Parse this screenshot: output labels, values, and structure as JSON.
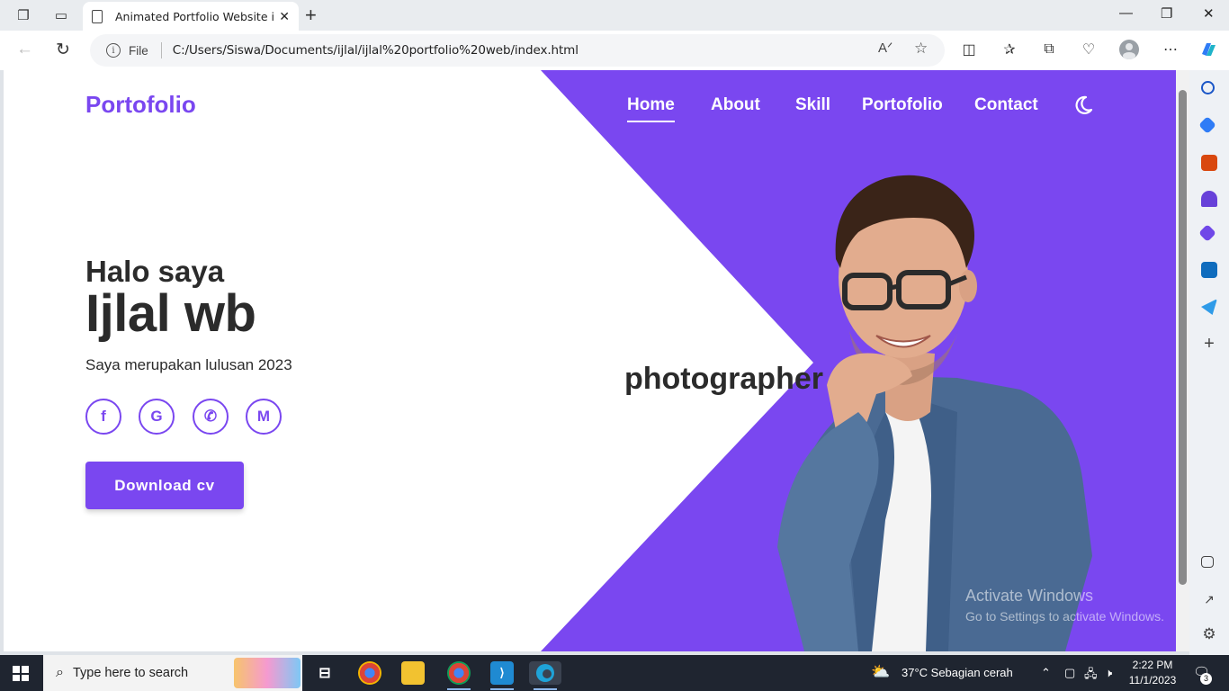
{
  "browser": {
    "tab_title": "Animated Portfolio Website in HTML",
    "address_prefix": "File",
    "url": "C:/Users/Siswa/Documents/ijlal/ijlal%20portfolio%20web/index.html"
  },
  "site": {
    "logo": "Portofolio",
    "nav": [
      "Home",
      "About",
      "Skill",
      "Portofolio",
      "Contact"
    ],
    "greeting": "Halo saya",
    "name": "Ijlal wb",
    "description": "Saya merupakan lulusan 2023",
    "social": [
      {
        "icon": "facebook-icon",
        "glyph": "f"
      },
      {
        "icon": "google-icon",
        "glyph": "G"
      },
      {
        "icon": "whatsapp-icon",
        "glyph": "✆"
      },
      {
        "icon": "gmail-icon",
        "glyph": "M"
      }
    ],
    "download_button": "Download cv",
    "role_text": "photographer",
    "accent_color": "#7a47f0"
  },
  "watermark": {
    "line1": "Activate Windows",
    "line2": "Go to Settings to activate Windows."
  },
  "taskbar": {
    "search_placeholder": "Type here to search",
    "weather": "37°C  Sebagian cerah",
    "time": "2:22 PM",
    "date": "11/1/2023",
    "notification_count": "3"
  }
}
